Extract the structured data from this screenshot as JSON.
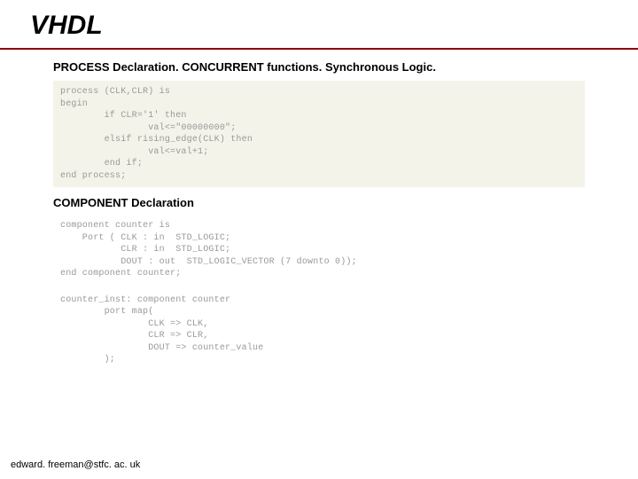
{
  "title": "VHDL",
  "heading1": "PROCESS Declaration.  CONCURRENT functions. Synchronous Logic.",
  "code1": "process (CLK,CLR) is\nbegin\n        if CLR='1' then\n                val<=\"00000000\";\n        elsif rising_edge(CLK) then\n                val<=val+1;\n        end if;\nend process;",
  "heading2": "COMPONENT Declaration",
  "code2": "component counter is\n    Port ( CLK : in  STD_LOGIC;\n           CLR : in  STD_LOGIC;\n           DOUT : out  STD_LOGIC_VECTOR (7 downto 0));\nend component counter;",
  "code3": "counter_inst: component counter\n        port map(\n                CLK => CLK,\n                CLR => CLR,\n                DOUT => counter_value\n        );",
  "footer": "edward. freeman@stfc. ac. uk"
}
